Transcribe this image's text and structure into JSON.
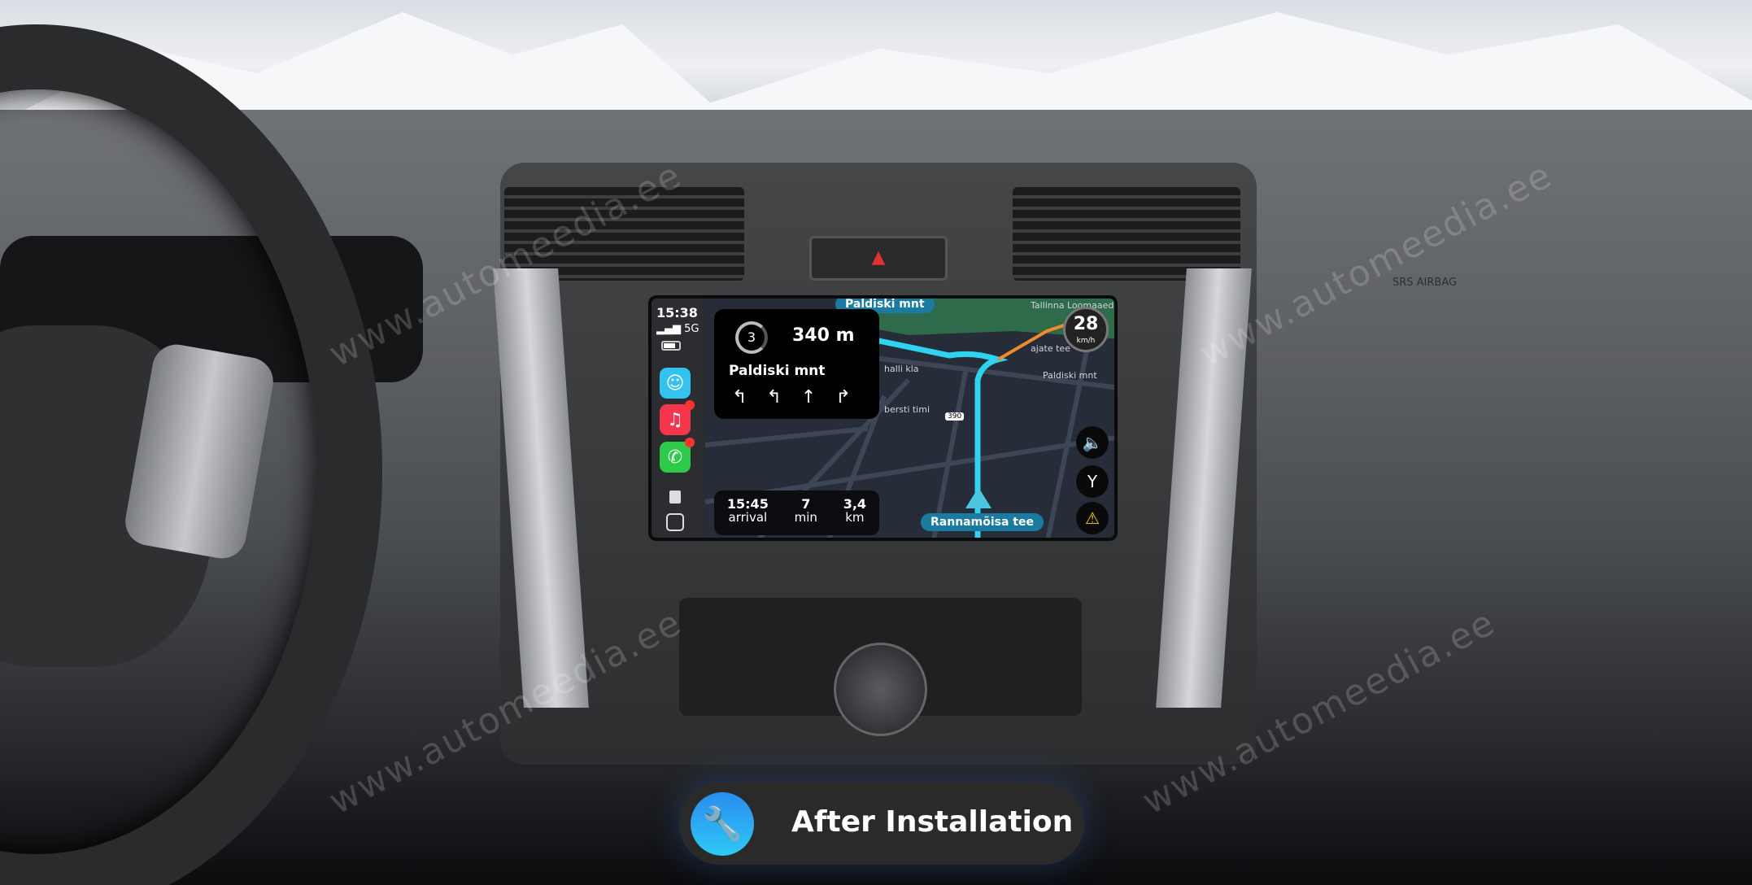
{
  "carplay": {
    "status": {
      "time": "15:38",
      "network": "5G"
    },
    "apps": [
      {
        "name": "Waze",
        "icon": "waze-icon",
        "color": "#34c3f0",
        "badge": false
      },
      {
        "name": "Music",
        "icon": "music-icon",
        "color": "#f5364d",
        "badge": true
      },
      {
        "name": "WhatsApp",
        "icon": "whatsapp-icon",
        "color": "#2ecb4a",
        "badge": true
      }
    ],
    "navigation": {
      "exit_number": "3",
      "distance": "340 m",
      "street": "Paldiski mnt",
      "lanes": [
        "↰",
        "↰",
        "↑",
        "↱"
      ],
      "eta": {
        "arrival_value": "15:45",
        "arrival_label": "arrival",
        "duration_value": "7",
        "duration_label": "min",
        "distance_value": "3,4",
        "distance_label": "km"
      },
      "speed": {
        "value": "28",
        "unit": "km/h"
      },
      "current_street": "Rannamõisa tee",
      "top_street": "Paldiski mnt",
      "map_labels": [
        "Tallinna Loomaaed",
        "ajate tee",
        "Paldiski mnt",
        "390",
        "halli kla",
        "bersti timi"
      ],
      "route_color": "#2fd3f0"
    }
  },
  "banner": {
    "label": "After Installation",
    "icon": "wrench-icon",
    "accent": "#2a9cf2"
  },
  "watermark": "www.automeedia.ee",
  "dashboard": {
    "hazard_symbol": "▲",
    "airbag_label": "SRS AIRBAG"
  }
}
